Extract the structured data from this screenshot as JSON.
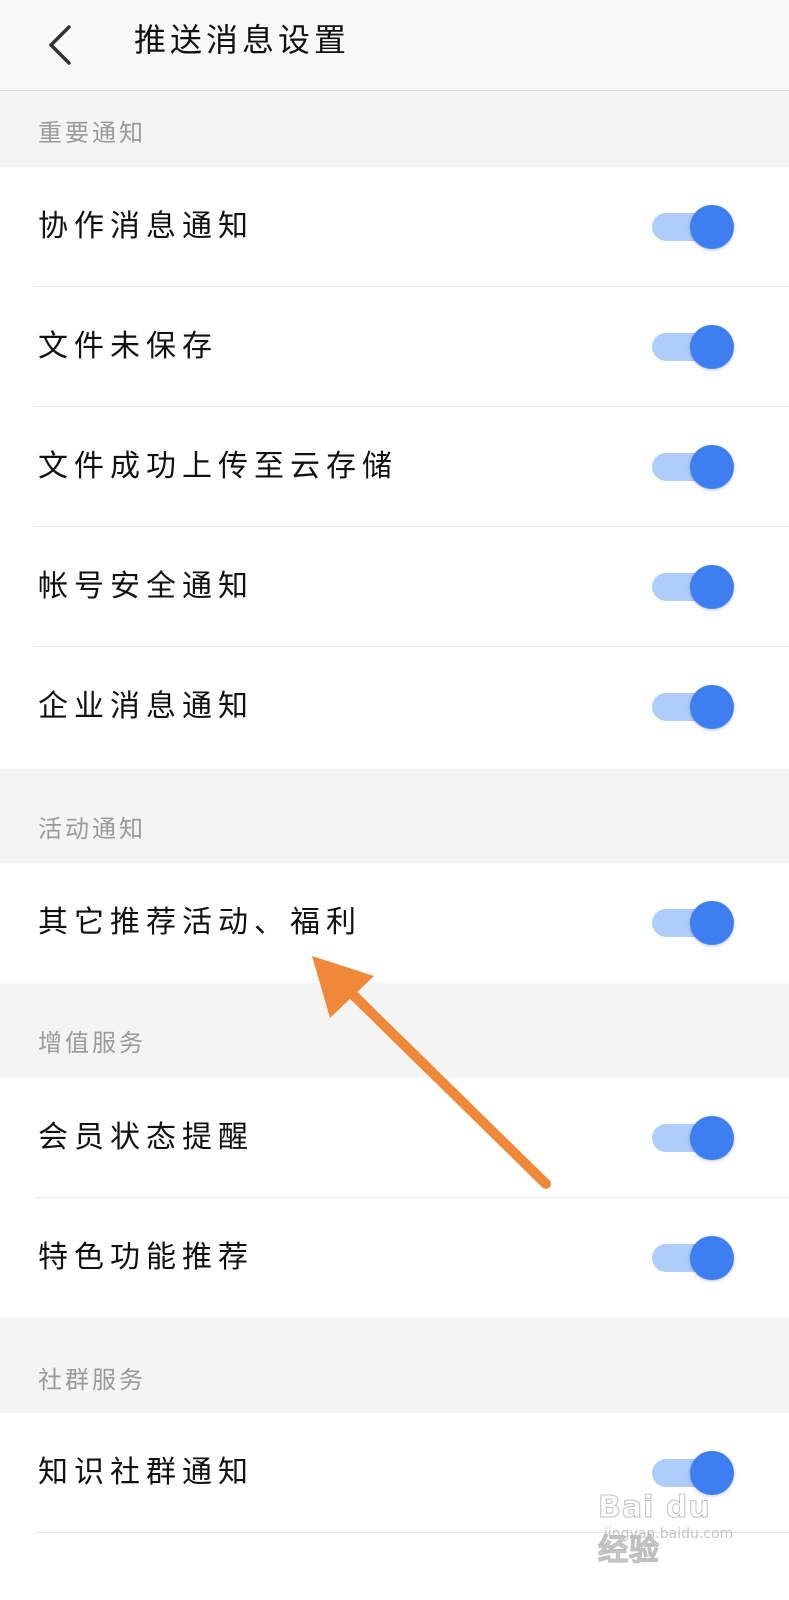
{
  "header": {
    "title": "推送消息设置",
    "back_icon": "chevron-left-icon"
  },
  "colors": {
    "toggle_on_knob": "#3d7ef0",
    "toggle_on_track": "#aecdfa",
    "annotation_arrow": "#f0883a"
  },
  "sections": [
    {
      "label": "重要通知",
      "items": [
        {
          "label": "协作消息通知",
          "enabled": true
        },
        {
          "label": "文件未保存",
          "enabled": true
        },
        {
          "label": "文件成功上传至云存储",
          "enabled": true
        },
        {
          "label": "帐号安全通知",
          "enabled": true
        },
        {
          "label": "企业消息通知",
          "enabled": true
        }
      ]
    },
    {
      "label": "活动通知",
      "items": [
        {
          "label": "其它推荐活动、福利",
          "enabled": true
        }
      ]
    },
    {
      "label": "增值服务",
      "items": [
        {
          "label": "会员状态提醒",
          "enabled": true
        },
        {
          "label": "特色功能推荐",
          "enabled": true
        }
      ]
    },
    {
      "label": "社群服务",
      "items": [
        {
          "label": "知识社群通知",
          "enabled": true
        }
      ]
    }
  ],
  "watermark": {
    "main": "Bai du 经验",
    "sub": "jingyan.baidu.com"
  }
}
